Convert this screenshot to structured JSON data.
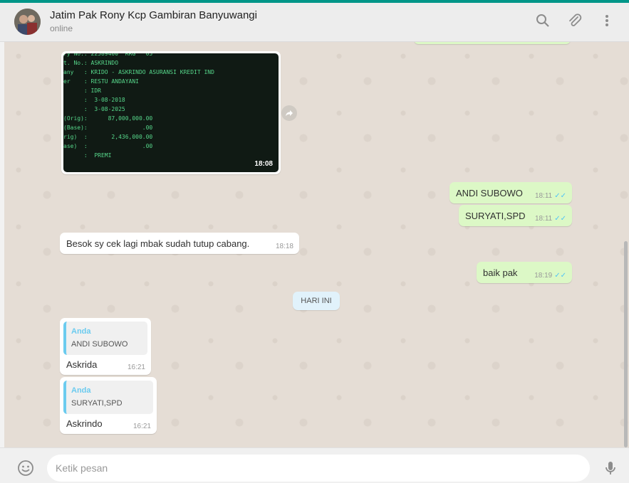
{
  "header": {
    "title": "Jatim Pak Rony Kcp Gambiran Banyuwangi",
    "status": "online",
    "icons": [
      "search-icon",
      "attach-icon",
      "menu-icon"
    ]
  },
  "messages": {
    "image": {
      "time": "18:08",
      "screen_text": "ry No.: 22589400  RRG   05\nt. No.: ASKRINDO\nany   : KRIDO - ASKRINDO ASURANSI KREDIT IND\ner    : RESTU ANDAYANI\n      : IDR\n      :  3-08-2018\n      :  3-08-2025\n(Orig):      87,000,000.00\n(Base):                .00\nrig)  :       2,436,000.00\nase)  :                .00\n      :  PREMI"
    },
    "out1": {
      "text": "ANDI SUBOWO",
      "time": "18:11"
    },
    "out2": {
      "text": "SURYATI,SPD",
      "time": "18:11"
    },
    "in1": {
      "text": "Besok sy cek lagi mbak sudah tutup cabang.",
      "time": "18:18"
    },
    "out3": {
      "text": "baik pak",
      "time": "18:19"
    },
    "day_badge": "HARI INI",
    "reply1": {
      "quote_author": "Anda",
      "quote_text": "ANDI SUBOWO",
      "text": "Askrida",
      "time": "16:21"
    },
    "reply2": {
      "quote_author": "Anda",
      "quote_text": "SURYATI,SPD",
      "text": "Askrindo",
      "time": "16:21"
    }
  },
  "footer": {
    "placeholder": "Ketik pesan"
  },
  "colors": {
    "accent": "#009688",
    "outgoing_bubble": "#dcf8c6",
    "incoming_bubble": "#ffffff",
    "read_ticks": "#4fc3f7"
  }
}
